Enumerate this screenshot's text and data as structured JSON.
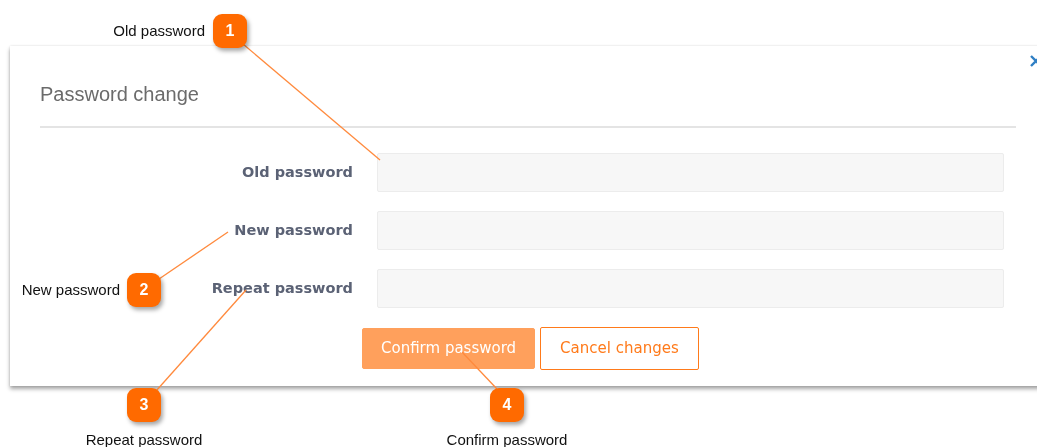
{
  "dialog": {
    "title": "Password change",
    "fields": [
      {
        "label": "Old password"
      },
      {
        "label": "New password"
      },
      {
        "label": "Repeat password"
      }
    ],
    "buttons": [
      {
        "label": "Confirm password",
        "kind": "primary"
      },
      {
        "label": "Cancel changes",
        "kind": "outline"
      }
    ]
  },
  "callouts": [
    {
      "number": "1",
      "label": "Old password"
    },
    {
      "number": "2",
      "label": "New password"
    },
    {
      "number": "3",
      "label": "Repeat password"
    },
    {
      "number": "4",
      "label": "Confirm password"
    }
  ]
}
